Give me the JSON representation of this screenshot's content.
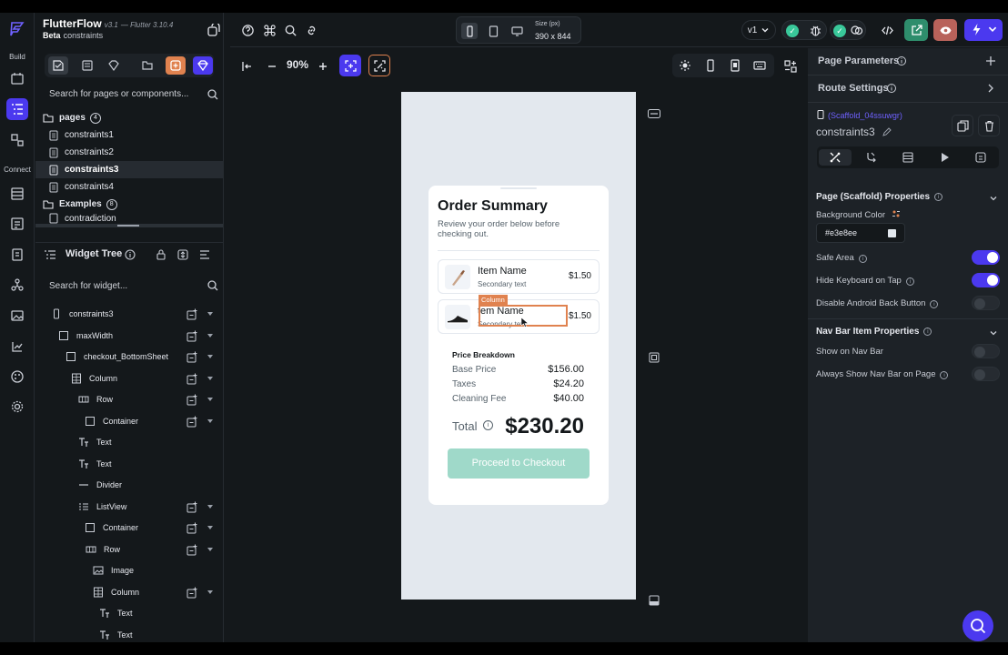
{
  "app": {
    "name": "FlutterFlow",
    "version": "v3.1",
    "flutter_version": "— Flutter 3.10.4",
    "channel": "Beta",
    "project": "constraints"
  },
  "rail": {
    "build_label": "Build",
    "connect_label": "Connect"
  },
  "left_panel": {
    "search_placeholder": "Search for pages or components...",
    "pages_label": "pages",
    "pages_count": "4",
    "pages": [
      "constraints1",
      "constraints2",
      "constraints3",
      "constraints4"
    ],
    "selected_page": "constraints3",
    "examples_label": "Examples",
    "examples_count": "8",
    "examples": [
      "contradiction"
    ]
  },
  "widget_tree": {
    "title": "Widget Tree",
    "search_placeholder": "Search for widget...",
    "nodes": [
      {
        "label": "constraints3",
        "icon": "phone-icon",
        "depth": 0,
        "has_add": true
      },
      {
        "label": "maxWidth",
        "icon": "container-icon",
        "depth": 1,
        "has_add": true
      },
      {
        "label": "checkout_BottomSheet",
        "icon": "container-icon",
        "depth": 2,
        "has_add": true
      },
      {
        "label": "Column",
        "icon": "column-icon",
        "depth": 3,
        "has_add": true
      },
      {
        "label": "Row",
        "icon": "row-icon",
        "depth": 4,
        "has_add": true
      },
      {
        "label": "Container",
        "icon": "container-icon",
        "depth": 5,
        "has_add": true
      },
      {
        "label": "Text",
        "icon": "text-icon",
        "depth": 4,
        "has_add": false
      },
      {
        "label": "Text",
        "icon": "text-icon",
        "depth": 4,
        "has_add": false
      },
      {
        "label": "Divider",
        "icon": "divider-icon",
        "depth": 4,
        "has_add": false
      },
      {
        "label": "ListView",
        "icon": "listview-icon",
        "depth": 4,
        "has_add": true
      },
      {
        "label": "Container",
        "icon": "container-icon",
        "depth": 5,
        "has_add": true
      },
      {
        "label": "Row",
        "icon": "row-icon",
        "depth": 6,
        "has_add": true
      },
      {
        "label": "Image",
        "icon": "image-icon",
        "depth": 7,
        "has_add": false
      },
      {
        "label": "Column",
        "icon": "column-icon",
        "depth": 7,
        "has_add": true
      },
      {
        "label": "Text",
        "icon": "text-icon",
        "depth": 8,
        "has_add": false
      },
      {
        "label": "Text",
        "icon": "text-icon",
        "depth": 8,
        "has_add": false
      }
    ]
  },
  "toolbar": {
    "size_label": "Size (px)",
    "size_value": "390 x 844",
    "version": "v1",
    "zoom": "90%"
  },
  "order": {
    "title": "Order Summary",
    "subtitle": "Review your order below before checking out.",
    "items": [
      {
        "name": "Item Name",
        "secondary": "Secondary text",
        "price": "$1.50"
      },
      {
        "name": "tem Name",
        "secondary": "Secondary text",
        "price": "$1.50"
      }
    ],
    "selection_tag": "Column",
    "breakdown_title": "Price Breakdown",
    "lines": [
      {
        "label": "Base Price",
        "value": "$156.00"
      },
      {
        "label": "Taxes",
        "value": "$24.20"
      },
      {
        "label": "Cleaning Fee",
        "value": "$40.00"
      }
    ],
    "total_label": "Total",
    "total_value": "$230.20",
    "checkout_label": "Proceed to Checkout"
  },
  "props": {
    "page_parameters": "Page Parameters",
    "route_settings": "Route Settings",
    "scaffold_id": "(Scaffold_04ssuwgr)",
    "page_name": "constraints3",
    "section1": "Page (Scaffold) Properties",
    "background_color_label": "Background Color",
    "background_color": "#e3e8ee",
    "safe_area": "Safe Area",
    "safe_area_on": true,
    "hide_keyboard": "Hide Keyboard on Tap",
    "hide_keyboard_on": true,
    "disable_back": "Disable Android Back Button",
    "disable_back_on": false,
    "section2": "Nav Bar Item Properties",
    "show_nav": "Show on Nav Bar",
    "show_nav_on": false,
    "always_show_nav": "Always Show Nav Bar on Page",
    "always_show_nav_on": false
  },
  "colors": {
    "accent": "#4b39ef",
    "selection": "#e0824f",
    "success": "#39c89a",
    "checkout_button": "#9fd9c9"
  }
}
